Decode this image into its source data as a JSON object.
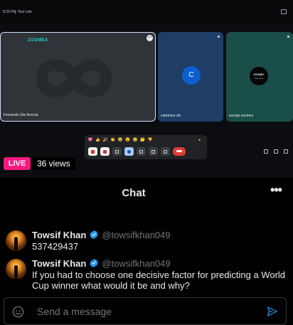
{
  "stream": {
    "meet_top": {
      "time": "8:25 PM",
      "link": "Test Link"
    },
    "tiles": [
      {
        "name": "Fernando Ulio Arreola",
        "brand": "ZOOMEX"
      },
      {
        "name": "catherine shi",
        "avatar_letter": "C"
      },
      {
        "name": "socials zoomex",
        "logo_text": "ZOOMEX",
        "logo_sub": "Pay Now"
      }
    ],
    "reactions": [
      "💖",
      "👍",
      "🎉",
      "👏",
      "😂",
      "😮",
      "😢",
      "🤔",
      "👎"
    ],
    "live_label": "LIVE",
    "views": "36 views",
    "colors": {
      "live": "#f91880",
      "end_call": "#e03c35",
      "brand": "#25d4d4"
    }
  },
  "chat": {
    "title": "Chat",
    "more_icon": "more-horizontal-icon",
    "messages": [
      {
        "name": "Towsif Khan",
        "handle": "@towsifkhan049",
        "verified": true,
        "text": "537429437"
      },
      {
        "name": "Towsif Khan",
        "handle": "@towsifkhan049",
        "verified": true,
        "text": "If you had to choose one decisive factor for predicting a World Cup winner what would it be and why?"
      }
    ],
    "composer": {
      "placeholder": "Send a message",
      "emoji_icon": "smiley-icon",
      "send_icon": "send-icon"
    },
    "colors": {
      "verified": "#1d9bf0",
      "send": "#1d9bf0",
      "muted": "#71767b"
    }
  }
}
